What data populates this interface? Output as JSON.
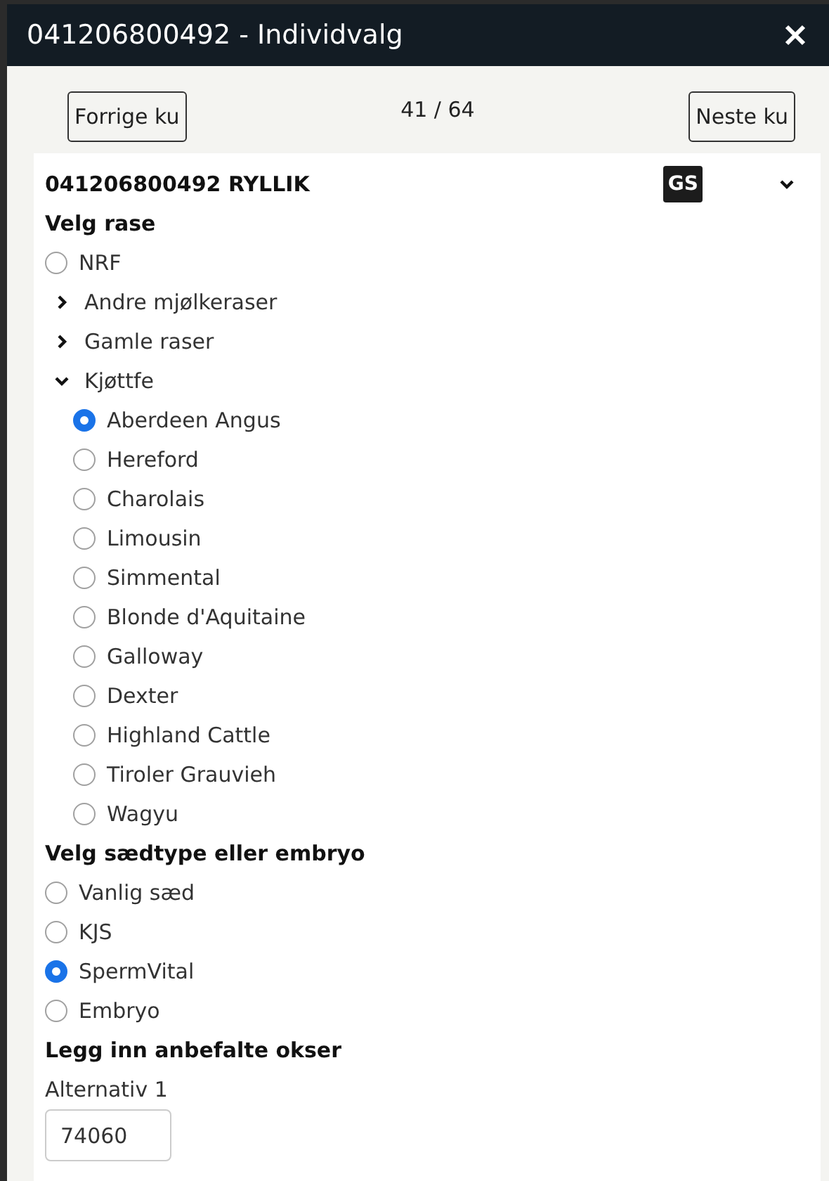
{
  "dialog": {
    "title": "041206800492 - Individvalg"
  },
  "nav": {
    "previous": "Forrige ku",
    "counter": "41 / 64",
    "next": "Neste ku"
  },
  "card": {
    "title": "041206800492 RYLLIK",
    "badge": "GS",
    "expanded": true,
    "breed": {
      "heading": "Velg rase",
      "options": [
        {
          "kind": "radio",
          "label": "NRF",
          "selected": false
        },
        {
          "kind": "group",
          "label": "Andre mjølkeraser",
          "expanded": false
        },
        {
          "kind": "group",
          "label": "Gamle raser",
          "expanded": false
        },
        {
          "kind": "group",
          "label": "Kjøttfe",
          "expanded": true,
          "children": [
            {
              "label": "Aberdeen Angus",
              "selected": true
            },
            {
              "label": "Hereford",
              "selected": false
            },
            {
              "label": "Charolais",
              "selected": false
            },
            {
              "label": "Limousin",
              "selected": false
            },
            {
              "label": "Simmental",
              "selected": false
            },
            {
              "label": "Blonde d'Aquitaine",
              "selected": false
            },
            {
              "label": "Galloway",
              "selected": false
            },
            {
              "label": "Dexter",
              "selected": false
            },
            {
              "label": "Highland Cattle",
              "selected": false
            },
            {
              "label": "Tiroler Grauvieh",
              "selected": false
            },
            {
              "label": "Wagyu",
              "selected": false
            }
          ]
        }
      ]
    },
    "semen": {
      "heading": "Velg sædtype eller embryo",
      "options": [
        {
          "label": "Vanlig sæd",
          "selected": false
        },
        {
          "label": "KJS",
          "selected": false
        },
        {
          "label": "SpermVital",
          "selected": true
        },
        {
          "label": "Embryo",
          "selected": false
        }
      ]
    },
    "bulls": {
      "heading": "Legg inn anbefalte okser",
      "fields": [
        {
          "label": "Alternativ 1",
          "value": "74060"
        }
      ]
    }
  }
}
